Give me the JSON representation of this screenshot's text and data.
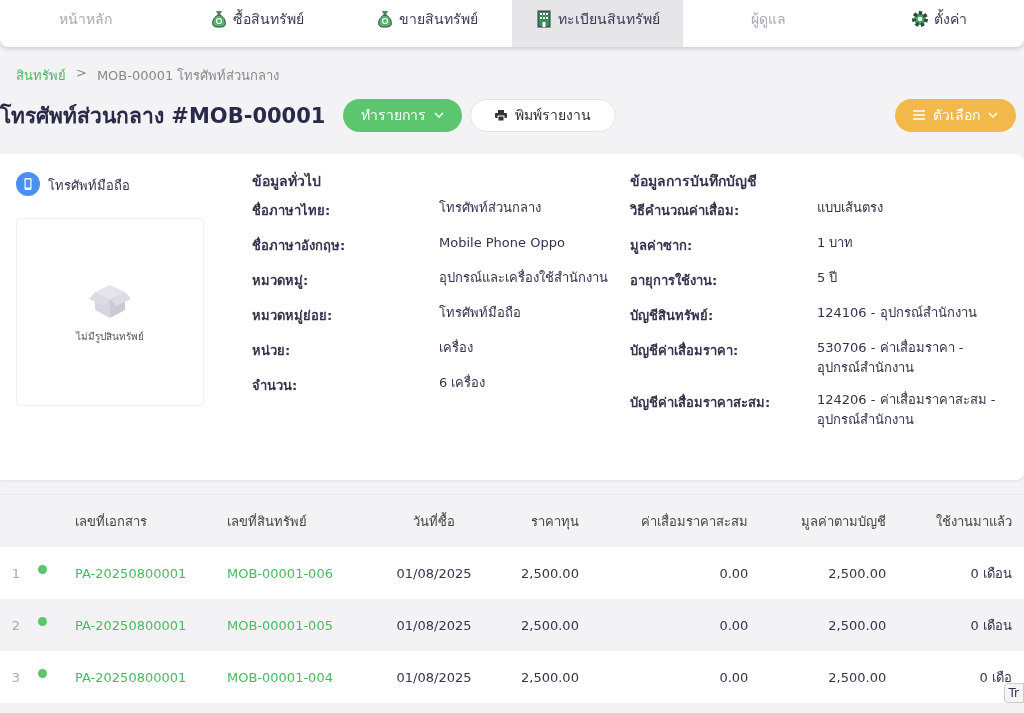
{
  "nav": [
    {
      "label": "หน้าหลัก",
      "kind": "plain",
      "selected": false,
      "disabled": true
    },
    {
      "label": "ซื้อสินทรัพย์",
      "kind": "bag",
      "selected": false,
      "disabled": false
    },
    {
      "label": "ขายสินทรัพย์",
      "kind": "bag",
      "selected": false,
      "disabled": false
    },
    {
      "label": "ทะเบียนสินทรัพย์",
      "kind": "building",
      "selected": true,
      "disabled": false
    },
    {
      "label": "ผู้ดูแล",
      "kind": "plain",
      "selected": false,
      "disabled": true
    },
    {
      "label": "ตั้งค่า",
      "kind": "gear",
      "selected": false,
      "disabled": false
    }
  ],
  "breadcrumb": [
    "สินทรัพย์",
    "MOB-00001 โทรศัพท์ส่วนกลาง"
  ],
  "breadcrumb_separator": ">",
  "title": "โทรศัพท์ส่วนกลาง #MOB-00001",
  "actions": [
    {
      "label": "ทำรายการ",
      "kind": "primary"
    },
    {
      "label": "พิมพ์รายงาน",
      "kind": "print"
    }
  ],
  "options_button": "ตัวเลือก",
  "category": "โทรศัพท์มือถือ",
  "image_placeholder": "ไม่มีรูปสินทรัพย์",
  "sections": [
    {
      "title": "ข้อมูลทั่วไป",
      "fields": [
        {
          "label": "ชื่อภาษาไทย:",
          "value": "โทรศัพท์ส่วนกลาง"
        },
        {
          "label": "ชื่อภาษาอังกฤษ:",
          "value": "Mobile Phone Oppo"
        },
        {
          "label": "หมวดหมู่:",
          "value": "อุปกรณ์และเครื่องใช้สำนักงาน"
        },
        {
          "label": "หมวดหมู่ย่อย:",
          "value": "โทรศัพท์มือถือ"
        },
        {
          "label": "หน่วย:",
          "value": "เครื่อง"
        },
        {
          "label": "จำนวน:",
          "value": "6 เครื่อง"
        }
      ]
    },
    {
      "title": "ข้อมูลการบันทึกบัญชี",
      "fields": [
        {
          "label": "วิธีคำนวณค่าเสื่อม:",
          "value": "แบบเส้นตรง"
        },
        {
          "label": "มูลค่าซาก:",
          "value": "1 บาท"
        },
        {
          "label": "อายุการใช้งาน:",
          "value": "5 ปี"
        },
        {
          "label": "บัญชีสินทรัพย์:",
          "value": "124106 - อุปกรณ์สำนักงาน"
        },
        {
          "label": "บัญชีค่าเสื่อมราคา:",
          "value": "530706 - ค่าเสื่อมราคา - อุปกรณ์สำนักงาน"
        },
        {
          "label": "บัญชีค่าเสื่อมราคาสะสม:",
          "value": "124206 - ค่าเสื่อมราคาสะสม - อุปกรณ์สำนักงาน"
        }
      ]
    }
  ],
  "table": {
    "columns": [
      "เลขที่เอกสาร",
      "เลขที่สินทรัพย์",
      "วันที่ซื้อ",
      "ราคาทุน",
      "ค่าเสื่อมราคาสะสม",
      "มูลค่าตามบัญชี",
      "ใช้งานมาแล้ว"
    ],
    "rows": [
      {
        "index": "1",
        "color": "#5cc36e",
        "cells": [
          "PA-20250800001",
          "MOB-00001-006",
          "01/08/2025",
          "2,500.00",
          "0.00",
          "2,500.00",
          "0 เดือน"
        ]
      },
      {
        "index": "2",
        "color": "#5cc36e",
        "cells": [
          "PA-20250800001",
          "MOB-00001-005",
          "01/08/2025",
          "2,500.00",
          "0.00",
          "2,500.00",
          "0 เดือน"
        ]
      },
      {
        "index": "3",
        "color": "#5cc36e",
        "cells": [
          "PA-20250800001",
          "MOB-00001-004",
          "01/08/2025",
          "2,500.00",
          "0.00",
          "2,500.00",
          "0 เดือ"
        ]
      }
    ]
  },
  "tooltip": "Tr"
}
